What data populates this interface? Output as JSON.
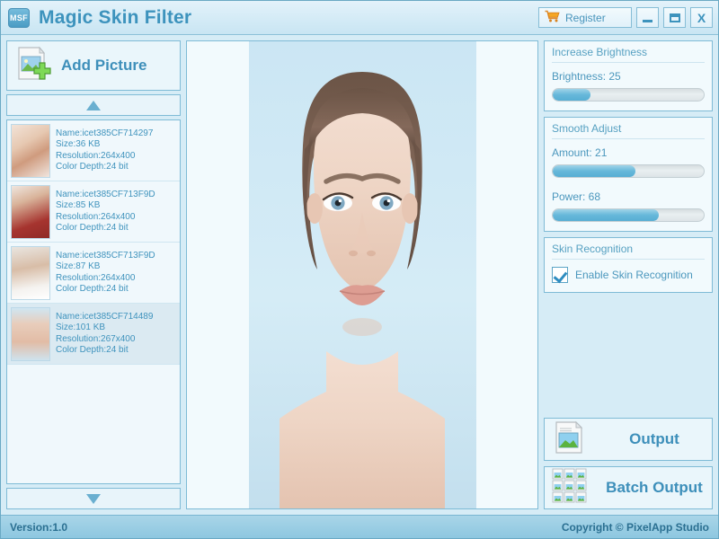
{
  "window": {
    "title": "Magic Skin Filter",
    "icon_text": "MSF",
    "register_label": "Register",
    "minimize_label": "",
    "maximize_label": "",
    "close_label": "X"
  },
  "left": {
    "add_picture_label": "Add Picture",
    "scroll_up_icon": "triangle-up-icon",
    "scroll_down_icon": "triangle-down-icon",
    "files": [
      {
        "name": "Name:icet385CF714297",
        "size": "Size:36 KB",
        "resolution": "Resolution:264x400",
        "depth": "Color Depth:24 bit",
        "selected": false
      },
      {
        "name": "Name:icet385CF713F9D",
        "size": "Size:85 KB",
        "resolution": "Resolution:264x400",
        "depth": "Color Depth:24 bit",
        "selected": false
      },
      {
        "name": "Name:icet385CF713F9D",
        "size": "Size:87 KB",
        "resolution": "Resolution:264x400",
        "depth": "Color Depth:24 bit",
        "selected": false
      },
      {
        "name": "Name:icet385CF714489",
        "size": "Size:101 KB",
        "resolution": "Resolution:267x400",
        "depth": "Color Depth:24 bit",
        "selected": true
      }
    ]
  },
  "right": {
    "brightness_panel": {
      "title": "Increase Brightness",
      "slider_label": "Brightness: 25",
      "value": 25,
      "fill_percent": 25
    },
    "smooth_panel": {
      "title": "Smooth Adjust",
      "amount_label": "Amount: 21",
      "amount_value": 21,
      "amount_fill_percent": 55,
      "power_label": "Power: 68",
      "power_value": 68,
      "power_fill_percent": 70
    },
    "skin_panel": {
      "title": "Skin Recognition",
      "checkbox_label": "Enable Skin Recognition",
      "checked": true
    },
    "output_label": "Output",
    "batch_output_label": "Batch Output"
  },
  "status": {
    "version": "Version:1.0",
    "copyright": "Copyright © PixelApp Studio"
  },
  "colors": {
    "accent": "#3d93bd",
    "panel_bg": "#f2fafd",
    "border": "#7fbbd6",
    "statusbar": "#8dc7e0"
  }
}
